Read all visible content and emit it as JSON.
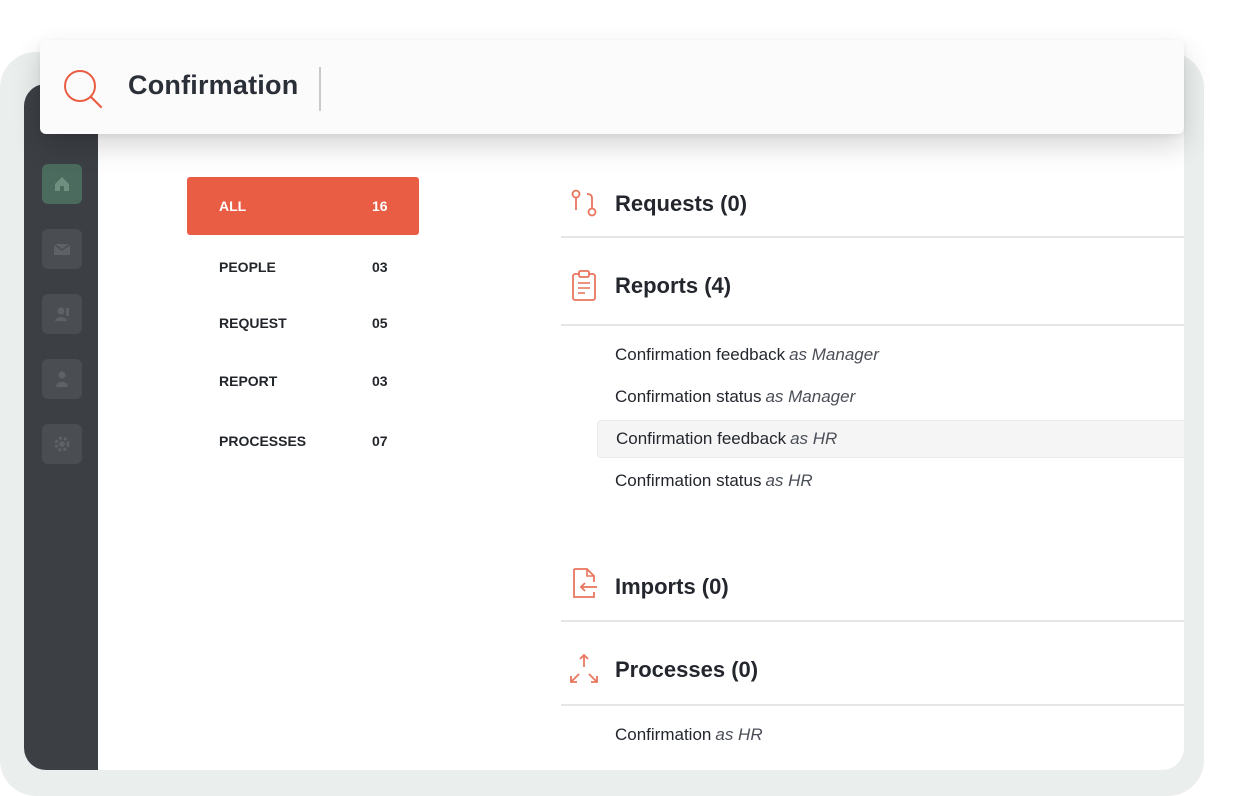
{
  "search": {
    "query": "Confirmation"
  },
  "sidebar": {
    "items": [
      {
        "icon": "home-icon",
        "active": true
      },
      {
        "icon": "mail-icon",
        "active": false
      },
      {
        "icon": "contact-icon",
        "active": false
      },
      {
        "icon": "person-icon",
        "active": false
      },
      {
        "icon": "gear-icon",
        "active": false
      }
    ]
  },
  "filters": [
    {
      "label": "ALL",
      "count": "16",
      "active": true
    },
    {
      "label": "PEOPLE",
      "count": "03",
      "active": false
    },
    {
      "label": "REQUEST",
      "count": "05",
      "active": false
    },
    {
      "label": "REPORT",
      "count": "03",
      "active": false
    },
    {
      "label": "PROCESSES",
      "count": "07",
      "active": false
    }
  ],
  "sections": {
    "requests": {
      "title": "Requests (0)",
      "icon": "request-icon"
    },
    "reports": {
      "title": "Reports (4)",
      "icon": "clipboard-icon",
      "items": [
        {
          "name": "Confirmation feedback",
          "role": "as Manager"
        },
        {
          "name": "Confirmation status",
          "role": "as Manager"
        },
        {
          "name": "Confirmation feedback",
          "role": "as HR"
        },
        {
          "name": "Confirmation status",
          "role": "as HR"
        }
      ]
    },
    "imports": {
      "title": "Imports (0)",
      "icon": "import-icon"
    },
    "processes": {
      "title": "Processes (0)",
      "icon": "processes-icon",
      "items": [
        {
          "name": "Confirmation",
          "role": "as HR"
        }
      ]
    }
  },
  "colors": {
    "accent": "#e95d45",
    "icon_stroke": "#e8765f",
    "sidebar": "#3c3f44",
    "active_nav": "#4a6b5d"
  }
}
